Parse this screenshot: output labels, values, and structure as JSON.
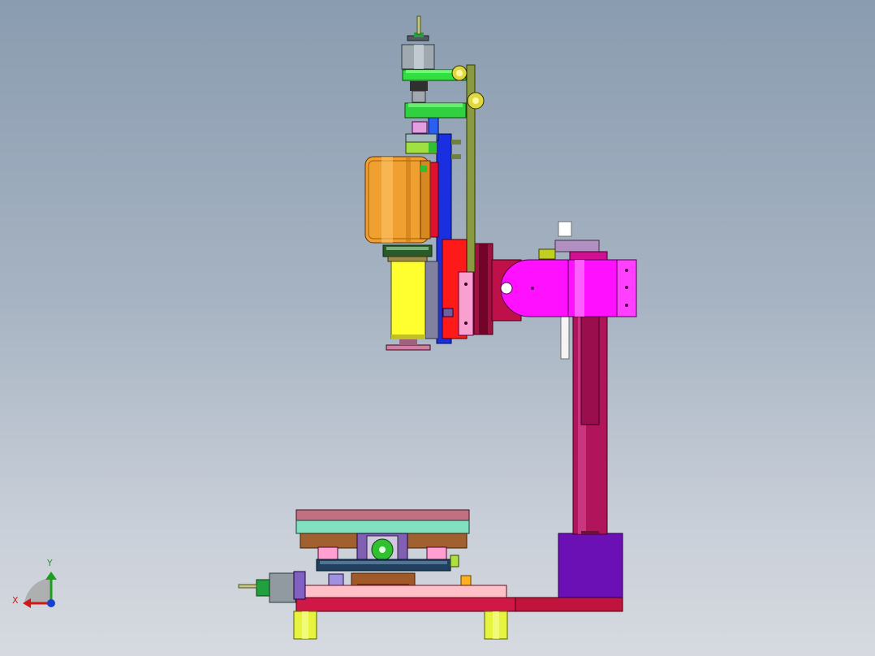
{
  "scene": {
    "title": "",
    "background": {
      "top": "#8a9cb0",
      "bottom": "#d6dae0"
    }
  },
  "triad": {
    "y_label": "Y",
    "x_label": "X",
    "colors": {
      "x": "#d01818",
      "y": "#1aa01a",
      "z": "#1a3fd0"
    }
  },
  "colors": {
    "base_red": "#c0143c",
    "column_purple": "#b0145a",
    "column_block": "#6a10b4",
    "arm_magenta": "#ff10ff",
    "motor_orange": "#f0a030",
    "motor_yellow": "#ffff30",
    "belt_green": "#30e040",
    "blue_plate": "#1a30e0",
    "table_mint": "#80e0c0",
    "table_pink": "#f0a0b0",
    "foot_yellow": "#e0f040"
  }
}
